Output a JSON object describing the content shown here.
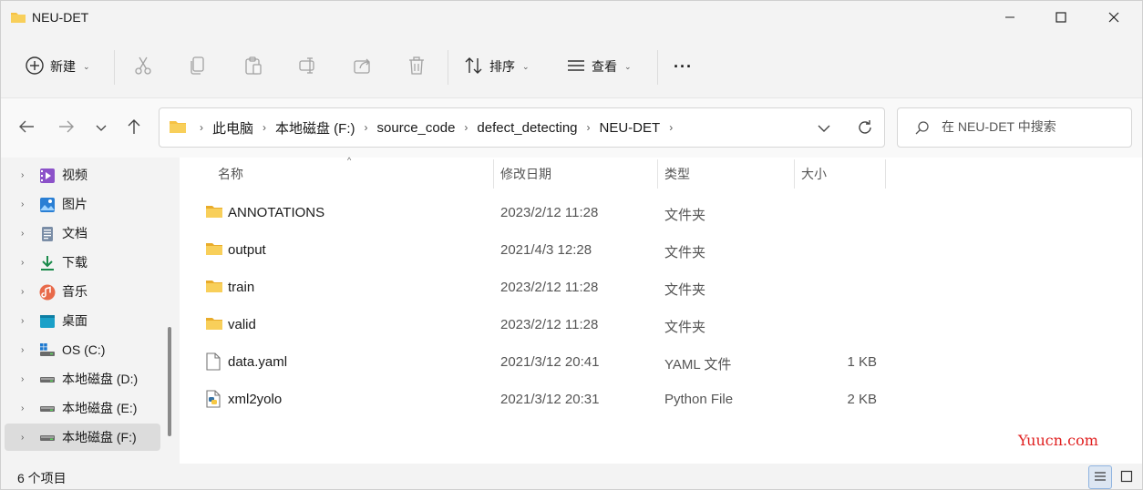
{
  "window": {
    "title": "NEU-DET"
  },
  "toolbar": {
    "new_label": "新建",
    "sort_label": "排序",
    "view_label": "查看",
    "more_label": "···"
  },
  "address": {
    "crumbs": [
      "此电脑",
      "本地磁盘 (F:)",
      "source_code",
      "defect_detecting",
      "NEU-DET"
    ]
  },
  "search": {
    "placeholder": "在 NEU-DET 中搜索"
  },
  "sidebar": {
    "items": [
      {
        "label": "视频",
        "icon": "video-icon"
      },
      {
        "label": "图片",
        "icon": "picture-icon"
      },
      {
        "label": "文档",
        "icon": "document-icon"
      },
      {
        "label": "下载",
        "icon": "download-icon"
      },
      {
        "label": "音乐",
        "icon": "music-icon"
      },
      {
        "label": "桌面",
        "icon": "desktop-icon"
      },
      {
        "label": "OS (C:)",
        "icon": "windows-drive-icon"
      },
      {
        "label": "本地磁盘 (D:)",
        "icon": "drive-icon"
      },
      {
        "label": "本地磁盘 (E:)",
        "icon": "drive-icon"
      },
      {
        "label": "本地磁盘 (F:)",
        "icon": "drive-icon",
        "selected": true
      }
    ]
  },
  "columns": {
    "name": "名称",
    "modified": "修改日期",
    "type": "类型",
    "size": "大小"
  },
  "files": [
    {
      "name": "ANNOTATIONS",
      "modified": "2023/2/12 11:28",
      "type": "文件夹",
      "size": "",
      "icon": "folder-icon"
    },
    {
      "name": "output",
      "modified": "2021/4/3 12:28",
      "type": "文件夹",
      "size": "",
      "icon": "folder-icon"
    },
    {
      "name": "train",
      "modified": "2023/2/12 11:28",
      "type": "文件夹",
      "size": "",
      "icon": "folder-icon"
    },
    {
      "name": "valid",
      "modified": "2023/2/12 11:28",
      "type": "文件夹",
      "size": "",
      "icon": "folder-icon"
    },
    {
      "name": "data.yaml",
      "modified": "2021/3/12 20:41",
      "type": "YAML 文件",
      "size": "1 KB",
      "icon": "file-icon"
    },
    {
      "name": "xml2yolo",
      "modified": "2021/3/12 20:31",
      "type": "Python File",
      "size": "2 KB",
      "icon": "python-file-icon"
    }
  ],
  "status": {
    "count": "6 个项目"
  },
  "watermark": "Yuucn.com",
  "colors": {
    "folder": "#f6c244",
    "accent": "#0067c0",
    "watermark": "#e02020"
  }
}
